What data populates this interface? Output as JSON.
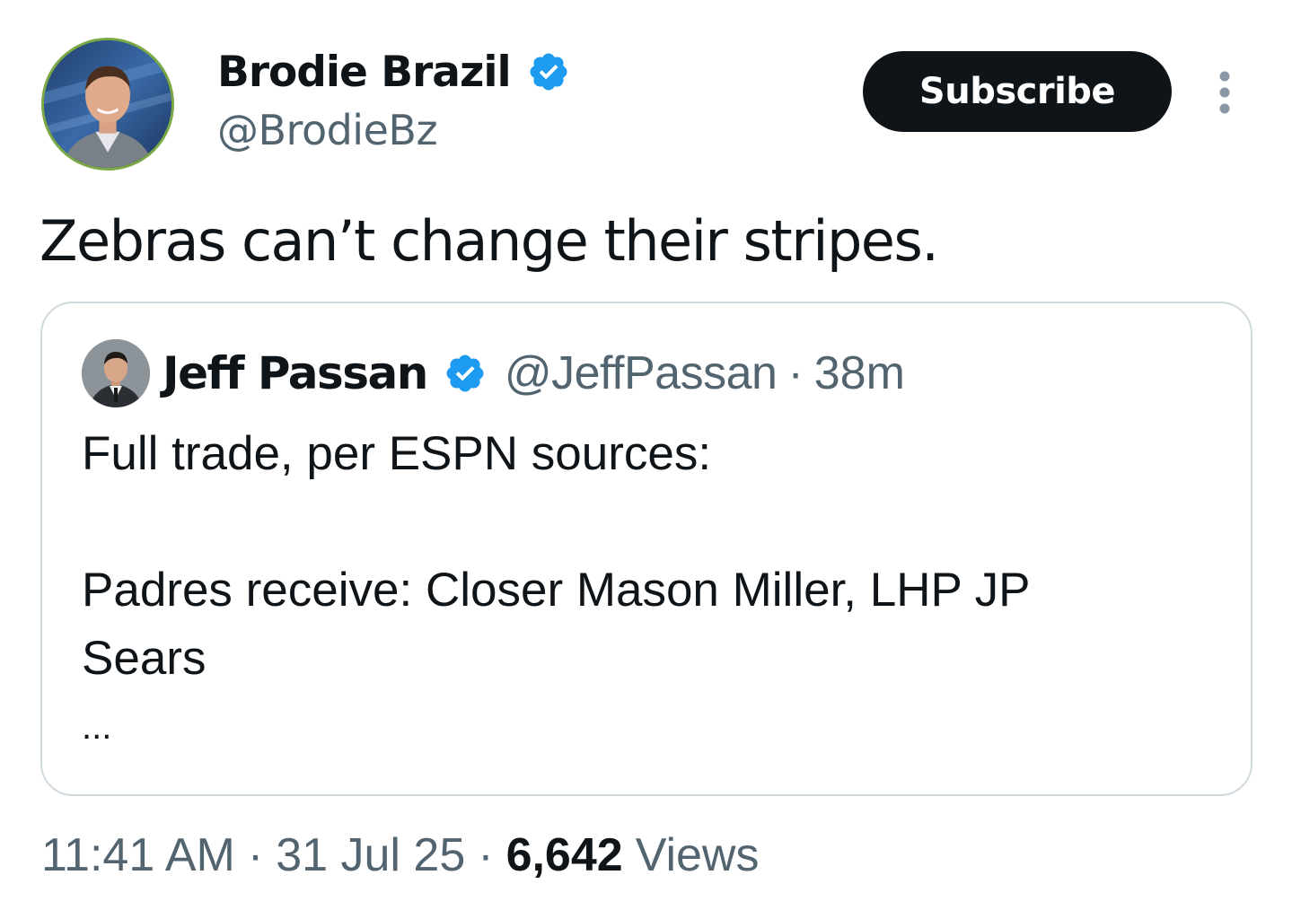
{
  "author": {
    "name": "Brodie Brazil",
    "handle": "@BrodieBz",
    "verified_icon": "verified-badge-icon"
  },
  "subscribe_label": "Subscribe",
  "more_icon": "more-vertical-icon",
  "tweet_text": "Zebras can’t change their stripes.",
  "quote": {
    "name": "Jeff Passan",
    "handle": "@JeffPassan",
    "separator": "·",
    "time": "38m",
    "body_line_1": "Full trade, per ESPN sources:",
    "body_line_2": "Padres receive: Closer Mason Miller, LHP JP",
    "body_line_3": "Sears",
    "ellipsis": "..."
  },
  "meta": {
    "time": "11:41 AM",
    "separator": "·",
    "date": "31 Jul 25",
    "views_count": "6,642",
    "views_label": "Views"
  },
  "colors": {
    "text_primary": "#0f1419",
    "text_secondary": "#536471",
    "verified_blue": "#1d9bf0",
    "button_bg": "#0f1419",
    "border": "#cfd9de"
  }
}
